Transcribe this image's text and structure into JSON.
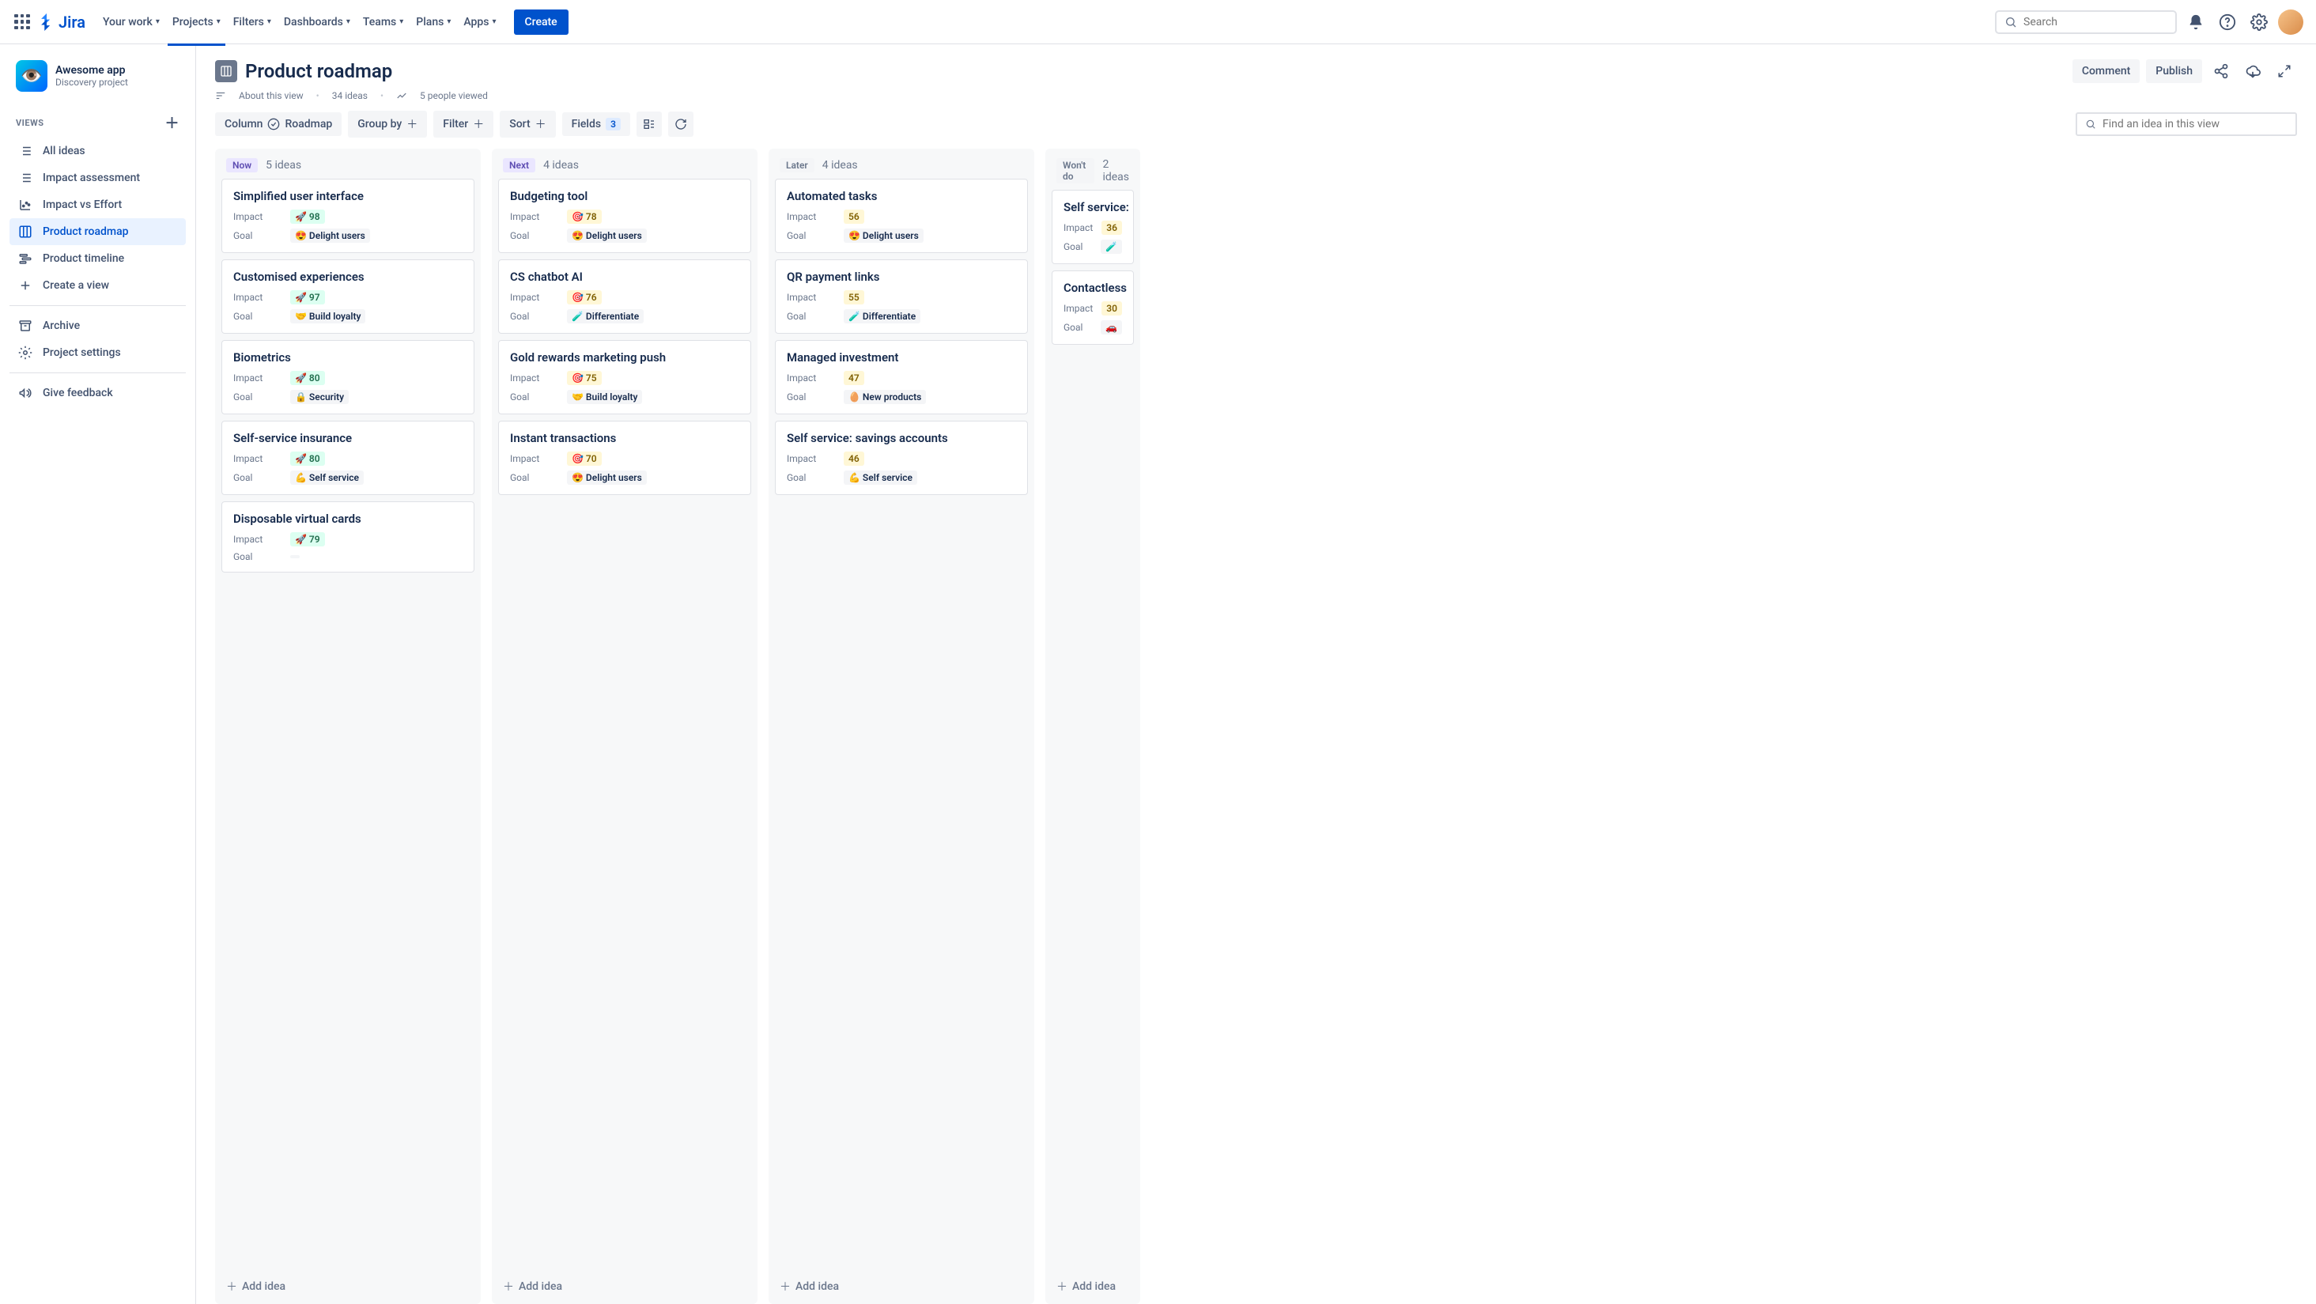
{
  "topbar": {
    "logo_text": "Jira",
    "nav": [
      "Your work",
      "Projects",
      "Filters",
      "Dashboards",
      "Teams",
      "Plans",
      "Apps"
    ],
    "active_nav_index": 1,
    "create": "Create",
    "search_placeholder": "Search"
  },
  "sidebar": {
    "project_name": "Awesome app",
    "project_subtitle": "Discovery project",
    "views_label": "VIEWS",
    "views": [
      {
        "label": "All ideas",
        "icon": "list"
      },
      {
        "label": "Impact assessment",
        "icon": "list"
      },
      {
        "label": "Impact vs Effort",
        "icon": "chart"
      },
      {
        "label": "Product roadmap",
        "icon": "board",
        "active": true
      },
      {
        "label": "Product timeline",
        "icon": "timeline"
      },
      {
        "label": "Create a view",
        "icon": "plus"
      }
    ],
    "archive": "Archive",
    "settings": "Project settings",
    "feedback": "Give feedback"
  },
  "header": {
    "title": "Product roadmap",
    "about": "About this view",
    "ideas_count": "34 ideas",
    "viewed": "5 people viewed",
    "comment": "Comment",
    "publish": "Publish"
  },
  "toolbar": {
    "column": "Column",
    "roadmap": "Roadmap",
    "group_by": "Group by",
    "filter": "Filter",
    "sort": "Sort",
    "fields": "Fields",
    "fields_count": "3",
    "find_placeholder": "Find an idea in this view"
  },
  "columns": [
    {
      "tag": "Now",
      "tag_class": "tag-now",
      "count": "5 ideas",
      "cards": [
        {
          "title": "Simplified user interface",
          "impact": "98",
          "impact_class": "impact-green",
          "impact_icon": "🚀",
          "goal": "Delight users",
          "goal_icon": "😍"
        },
        {
          "title": "Customised experiences",
          "impact": "97",
          "impact_class": "impact-green",
          "impact_icon": "🚀",
          "goal": "Build loyalty",
          "goal_icon": "🤝"
        },
        {
          "title": "Biometrics",
          "impact": "80",
          "impact_class": "impact-green",
          "impact_icon": "🚀",
          "goal": "Security",
          "goal_icon": "🔒"
        },
        {
          "title": "Self-service insurance",
          "impact": "80",
          "impact_class": "impact-green",
          "impact_icon": "🚀",
          "goal": "Self service",
          "goal_icon": "💪"
        },
        {
          "title": "Disposable virtual cards",
          "impact": "79",
          "impact_class": "impact-green",
          "impact_icon": "🚀",
          "goal": "",
          "goal_icon": ""
        }
      ]
    },
    {
      "tag": "Next",
      "tag_class": "tag-next",
      "count": "4 ideas",
      "cards": [
        {
          "title": "Budgeting tool",
          "impact": "78",
          "impact_class": "impact-yellow",
          "impact_icon": "🎯",
          "goal": "Delight users",
          "goal_icon": "😍"
        },
        {
          "title": "CS chatbot AI",
          "impact": "76",
          "impact_class": "impact-yellow",
          "impact_icon": "🎯",
          "goal": "Differentiate",
          "goal_icon": "🧪"
        },
        {
          "title": "Gold rewards marketing push",
          "impact": "75",
          "impact_class": "impact-yellow",
          "impact_icon": "🎯",
          "goal": "Build loyalty",
          "goal_icon": "🤝"
        },
        {
          "title": "Instant transactions",
          "impact": "70",
          "impact_class": "impact-yellow",
          "impact_icon": "🎯",
          "goal": "Delight users",
          "goal_icon": "😍"
        }
      ]
    },
    {
      "tag": "Later",
      "tag_class": "tag-later",
      "count": "4 ideas",
      "cards": [
        {
          "title": "Automated tasks",
          "impact": "56",
          "impact_class": "impact-yellow",
          "impact_icon": "",
          "goal": "Delight users",
          "goal_icon": "😍"
        },
        {
          "title": "QR payment links",
          "impact": "55",
          "impact_class": "impact-yellow",
          "impact_icon": "",
          "goal": "Differentiate",
          "goal_icon": "🧪"
        },
        {
          "title": "Managed investment",
          "impact": "47",
          "impact_class": "impact-yellow",
          "impact_icon": "",
          "goal": "New products",
          "goal_icon": "🥚"
        },
        {
          "title": "Self service: savings accounts",
          "impact": "46",
          "impact_class": "impact-yellow",
          "impact_icon": "",
          "goal": "Self service",
          "goal_icon": "💪"
        }
      ]
    },
    {
      "tag": "Won't do",
      "tag_class": "tag-wont",
      "count": "2 ideas",
      "cards": [
        {
          "title": "Self service:",
          "impact": "36",
          "impact_class": "impact-yellow",
          "impact_icon": "",
          "goal": "",
          "goal_icon": "🧪"
        },
        {
          "title": "Contactless",
          "impact": "30",
          "impact_class": "impact-yellow",
          "impact_icon": "",
          "goal": "",
          "goal_icon": "🚗"
        }
      ]
    }
  ],
  "labels": {
    "impact": "Impact",
    "goal": "Goal",
    "add_idea": "Add idea"
  }
}
